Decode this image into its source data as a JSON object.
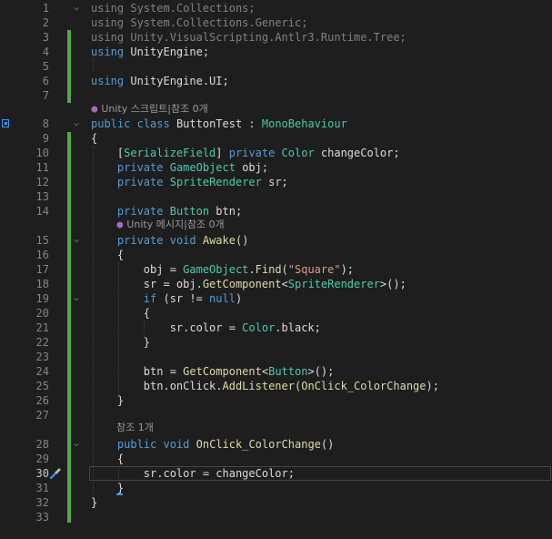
{
  "editor": {
    "current_line": "30",
    "lines": {
      "l1": {
        "num": "1",
        "p0": "using",
        "p1": " System.Collections;"
      },
      "l2": {
        "num": "2",
        "p0": "using",
        "p1": " System.Collections.Generic;"
      },
      "l3": {
        "num": "3",
        "p0": "using",
        "p1": " Unity.VisualScripting.Antlr3.Runtime.Tree;"
      },
      "l4": {
        "num": "4",
        "p0": "using",
        "p1": " UnityEngine;"
      },
      "l5": {
        "num": "5"
      },
      "l6": {
        "num": "6",
        "p0": "using",
        "p1": " UnityEngine.UI;"
      },
      "l7": {
        "num": "7"
      },
      "lens1": {
        "icon": "⬢",
        "text": " Unity 스크립트|참조 0개"
      },
      "l8": {
        "num": "8",
        "p0": "public",
        "p1": " ",
        "p2": "class",
        "p3": " ButtonTest : ",
        "p4": "MonoBehaviour"
      },
      "l9": {
        "num": "9",
        "p0": "{"
      },
      "l10": {
        "num": "10",
        "p0": "    [",
        "p1": "SerializeField",
        "p2": "] ",
        "p3": "private",
        "p4": " ",
        "p5": "Color",
        "p6": " changeColor;"
      },
      "l11": {
        "num": "11",
        "p0": "    ",
        "p1": "private",
        "p2": " ",
        "p3": "GameObject",
        "p4": " obj;"
      },
      "l12": {
        "num": "12",
        "p0": "    ",
        "p1": "private",
        "p2": " ",
        "p3": "SpriteRenderer",
        "p4": " sr;"
      },
      "l13": {
        "num": "13"
      },
      "l14": {
        "num": "14",
        "p0": "    ",
        "p1": "private",
        "p2": " ",
        "p3": "Button",
        "p4": " btn;"
      },
      "lens2": {
        "icon": "⬢",
        "text": " Unity 메시지|참조 0개"
      },
      "l15": {
        "num": "15",
        "p0": "    ",
        "p1": "private",
        "p2": " ",
        "p3": "void",
        "p4": " ",
        "p5": "Awake",
        "p6": "()"
      },
      "l16": {
        "num": "16",
        "p0": "    {"
      },
      "l17": {
        "num": "17",
        "p0": "        obj = ",
        "p1": "GameObject",
        "p2": ".",
        "p3": "Find",
        "p4": "(",
        "p5": "\"Square\"",
        "p6": ");"
      },
      "l18": {
        "num": "18",
        "p0": "        sr = obj.",
        "p1": "GetComponent",
        "p2": "<",
        "p3": "SpriteRenderer",
        "p4": ">();"
      },
      "l19": {
        "num": "19",
        "p0": "        ",
        "p1": "if",
        "p2": " (sr != ",
        "p3": "null",
        "p4": ")"
      },
      "l20": {
        "num": "20",
        "p0": "        {"
      },
      "l21": {
        "num": "21",
        "p0": "            sr.color = ",
        "p1": "Color",
        "p2": ".black;"
      },
      "l22": {
        "num": "22",
        "p0": "        }"
      },
      "l23": {
        "num": "23"
      },
      "l24": {
        "num": "24",
        "p0": "        btn = ",
        "p1": "GetComponent",
        "p2": "<",
        "p3": "Button",
        "p4": ">();"
      },
      "l25": {
        "num": "25",
        "p0": "        btn.onClick.",
        "p1": "AddListener",
        "p2": "(",
        "p3": "OnClick_ColorChange",
        "p4": ");"
      },
      "l26": {
        "num": "26",
        "p0": "    }"
      },
      "l27": {
        "num": "27"
      },
      "lens3": {
        "text": "참조 1개"
      },
      "l28": {
        "num": "28",
        "p0": "    ",
        "p1": "public",
        "p2": " ",
        "p3": "void",
        "p4": " ",
        "p5": "OnClick_ColorChange",
        "p6": "()"
      },
      "l29": {
        "num": "29",
        "p0": "    {"
      },
      "l30": {
        "num": "30",
        "p0": "        sr.color = changeColor;"
      },
      "l31": {
        "num": "31",
        "p0": "    }"
      },
      "l32": {
        "num": "32",
        "p0": "}"
      },
      "l33": {
        "num": "33"
      }
    },
    "colors": {
      "background": "#1e1e1e",
      "keyword": "#569cd6",
      "type": "#4ec9b0",
      "method": "#dcdcaa",
      "string": "#d69d85",
      "change_bar": "#57a64a"
    },
    "icons": {
      "class_marker": "class-bookmark-icon",
      "quick_action": "screwdriver-icon",
      "unity_lens": "unity-icon"
    }
  }
}
